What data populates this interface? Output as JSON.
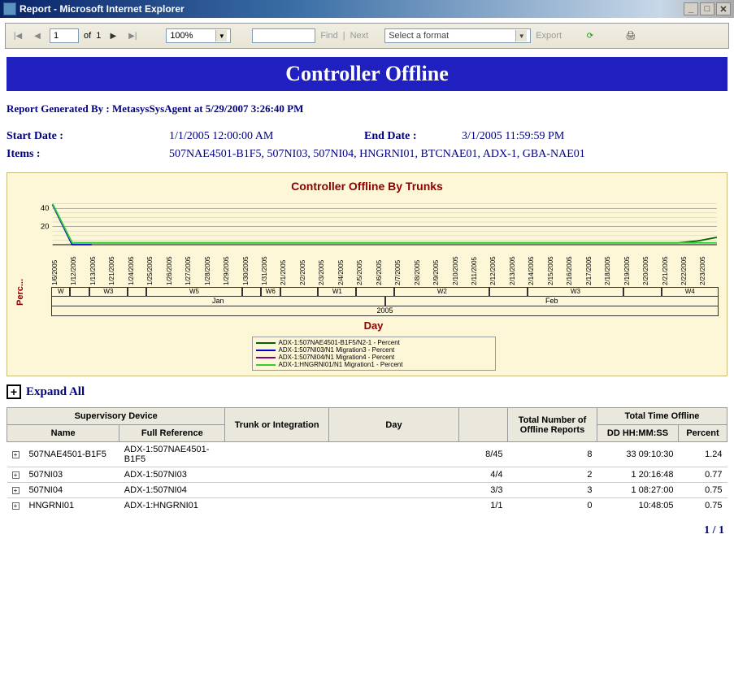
{
  "window": {
    "title": "Report - Microsoft Internet Explorer"
  },
  "toolbar": {
    "page_current": "1",
    "page_of": "of",
    "page_total": "1",
    "zoom": "100%",
    "find": "Find",
    "next": "Next",
    "export_placeholder": "Select a format",
    "export_label": "Export"
  },
  "report": {
    "title": "Controller Offline",
    "generated_prefix": "Report Generated By : ",
    "generated_by": "MetasysSysAgent",
    "generated_at": "at 5/29/2007 3:26:40 PM",
    "start_label": "Start Date :",
    "start_value": "1/1/2005 12:00:00 AM",
    "end_label": "End Date :",
    "end_value": "3/1/2005 11:59:59 PM",
    "items_label": "Items :",
    "items_value": "507NAE4501-B1F5, 507NI03, 507NI04, HNGRNI01, BTCNAE01, ADX-1, GBA-NAE01",
    "expand_all": "Expand All",
    "page_footer": "1 / 1"
  },
  "table": {
    "headers": {
      "supervisory_device": "Supervisory Device",
      "name": "Name",
      "full_reference": "Full Reference",
      "trunk": "Trunk or Integration",
      "day": "Day",
      "blank": "",
      "total_num": "Total Number of Offline Reports",
      "total_time": "Total Time Offline",
      "dd": "DD HH:MM:SS",
      "percent": "Percent"
    },
    "rows": [
      {
        "name": "507NAE4501-B1F5",
        "ref": "ADX-1:507NAE4501-B1F5",
        "ratio": "8/45",
        "num": "8",
        "dd": "33 09:10:30",
        "pct": "1.24"
      },
      {
        "name": "507NI03",
        "ref": "ADX-1:507NI03",
        "ratio": "4/4",
        "num": "2",
        "dd": "1 20:16:48",
        "pct": "0.77"
      },
      {
        "name": "507NI04",
        "ref": "ADX-1:507NI04",
        "ratio": "3/3",
        "num": "3",
        "dd": "1 08:27:00",
        "pct": "0.75"
      },
      {
        "name": "HNGRNI01",
        "ref": "ADX-1:HNGRNI01",
        "ratio": "1/1",
        "num": "0",
        "dd": "10:48:05",
        "pct": "0.75"
      }
    ]
  },
  "chart_data": {
    "type": "line",
    "title": "Controller Offline By Trunks",
    "ylabel": "Perc...",
    "xlabel": "Day",
    "ylim": [
      0,
      50
    ],
    "yticks": [
      20,
      40
    ],
    "categories": [
      "1/6/2005",
      "1/12/2005",
      "1/13/2005",
      "1/21/2005",
      "1/24/2005",
      "1/25/2005",
      "1/26/2005",
      "1/27/2005",
      "1/28/2005",
      "1/29/2005",
      "1/30/2005",
      "1/31/2005",
      "2/1/2005",
      "2/2/2005",
      "2/3/2005",
      "2/4/2005",
      "2/5/2005",
      "2/6/2005",
      "2/7/2005",
      "2/8/2005",
      "2/9/2005",
      "2/10/2005",
      "2/11/2005",
      "2/12/2005",
      "2/13/2005",
      "2/14/2005",
      "2/15/2005",
      "2/16/2005",
      "2/17/2005",
      "2/18/2005",
      "2/19/2005",
      "2/20/2005",
      "2/21/2005",
      "2/22/2005",
      "2/23/2005"
    ],
    "series": [
      {
        "name": "ADX-1:507NAE4501-B1F5/N2-1 - Percent",
        "color": "#006400",
        "values": [
          44,
          2,
          2,
          2,
          2,
          2,
          2,
          2,
          2,
          2,
          2,
          2,
          2,
          2,
          2,
          2,
          2,
          2,
          2,
          2,
          2,
          2,
          2,
          2,
          2,
          2,
          2,
          2,
          2,
          2,
          2,
          2,
          2,
          4,
          8
        ]
      },
      {
        "name": "ADX-1:507NI03/N1 Migration3 - Percent",
        "color": "#0000cd",
        "values": [
          44,
          0,
          0,
          null,
          null,
          null,
          null,
          null,
          null,
          null,
          null,
          null,
          null,
          null,
          null,
          null,
          null,
          null,
          null,
          null,
          null,
          null,
          null,
          null,
          null,
          null,
          null,
          null,
          null,
          null,
          null,
          null,
          null,
          null,
          null
        ]
      },
      {
        "name": "ADX-1:507NI04/N1 Migration4 - Percent",
        "color": "#800080",
        "values": [
          null,
          null,
          null,
          null,
          null,
          null,
          null,
          null,
          null,
          null,
          null,
          null,
          null,
          null,
          null,
          null,
          null,
          null,
          null,
          null,
          null,
          null,
          null,
          null,
          null,
          null,
          null,
          null,
          null,
          null,
          null,
          null,
          null,
          null,
          null
        ]
      },
      {
        "name": "ADX-1:HNGRNI01/N1 Migration1 - Percent",
        "color": "#32cd32",
        "values": [
          45,
          2,
          2,
          2,
          2,
          2,
          2,
          2,
          2,
          2,
          2,
          2,
          2,
          2,
          2,
          2,
          2,
          2,
          2,
          2,
          2,
          2,
          2,
          2,
          2,
          2,
          2,
          2,
          2,
          2,
          2,
          2,
          2,
          2,
          2
        ]
      }
    ],
    "week_spans": [
      {
        "label": "W",
        "width": 2.86
      },
      {
        "label": "",
        "width": 2.86
      },
      {
        "label": "W3",
        "width": 5.71
      },
      {
        "label": "",
        "width": 2.86
      },
      {
        "label": "W5",
        "width": 14.29
      },
      {
        "label": "",
        "width": 2.86
      },
      {
        "label": "W6",
        "width": 2.86
      },
      {
        "label": "",
        "width": 5.71
      },
      {
        "label": "W1",
        "width": 5.71
      },
      {
        "label": "",
        "width": 5.71
      },
      {
        "label": "W2",
        "width": 14.29
      },
      {
        "label": "",
        "width": 5.71
      },
      {
        "label": "W3",
        "width": 14.29
      },
      {
        "label": "",
        "width": 5.71
      },
      {
        "label": "W4",
        "width": 8.57
      }
    ],
    "month_spans": [
      {
        "label": "Jan",
        "width": 34.3
      },
      {
        "label": "Feb",
        "width": 65.7
      }
    ],
    "year_label": "2005"
  }
}
